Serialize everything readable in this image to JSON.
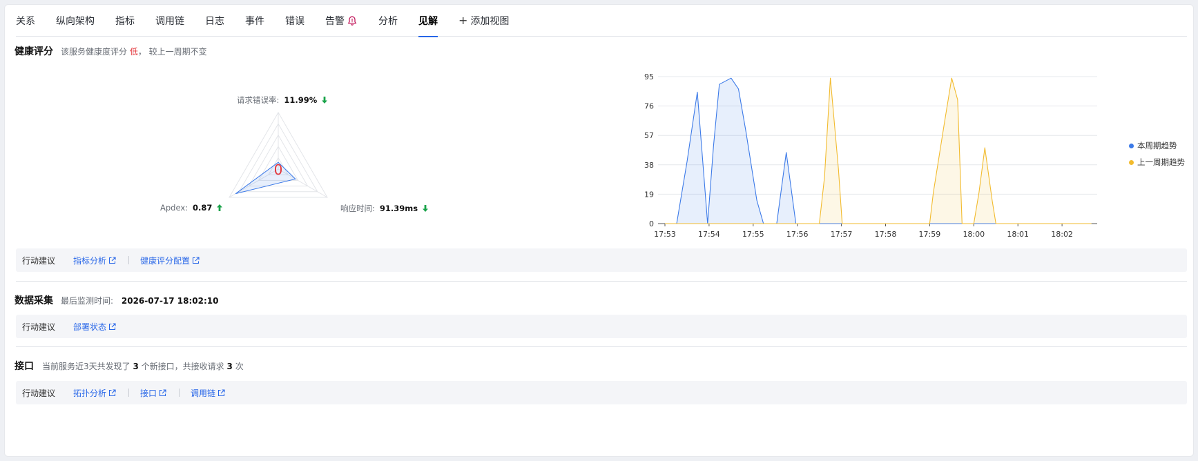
{
  "tabs": [
    "关系",
    "纵向架构",
    "指标",
    "调用链",
    "日志",
    "事件",
    "错误",
    "告警",
    "分析",
    "见解"
  ],
  "active_tab": "见解",
  "add_view_label": "添加视图",
  "health": {
    "title": "健康评分",
    "desc_prefix": "该服务健康度评分",
    "level": "低",
    "desc_suffix": "， 较上一周期不变",
    "score": "0",
    "error_rate_label": "请求错误率:",
    "error_rate_value": "11.99%",
    "apdex_label": "Apdex:",
    "apdex_value": "0.87",
    "resp_label": "响应时间:",
    "resp_value": "91.39ms",
    "radar_values": {
      "error_rate": 0.12,
      "apdex": 0.87,
      "response": 0.35
    }
  },
  "advice_label": "行动建议",
  "health_links": [
    "指标分析",
    "健康评分配置"
  ],
  "collect": {
    "title": "数据采集",
    "desc_label": "最后监测时间:",
    "last_time": "2026-07-17 18:02:10",
    "links": [
      "部署状态"
    ]
  },
  "api": {
    "title": "接口",
    "desc_p1": "当前服务近3天共发现了",
    "new_count": "3",
    "desc_p2": "个新接口，共接收请求",
    "req_count": "3",
    "desc_p3": "次",
    "links": [
      "拓扑分析",
      "接口",
      "调用链"
    ]
  },
  "colors": {
    "accent": "#2766e8",
    "current": "#3c7ae8",
    "previous": "#f2bb2e",
    "danger": "#e3363b",
    "good": "#1aa34a"
  },
  "chart_data": {
    "type": "area",
    "x_ticks": [
      "17:53",
      "17:54",
      "17:55",
      "17:56",
      "17:57",
      "17:58",
      "17:59",
      "18:00",
      "18:01",
      "18:02"
    ],
    "y_ticks": [
      0,
      19,
      38,
      57,
      76,
      95
    ],
    "ylim": [
      0,
      95
    ],
    "legend": [
      "本周期趋势",
      "上一周期趋势"
    ],
    "legend_position": "right",
    "grid": true,
    "series": [
      {
        "name": "本周期趋势",
        "points": [
          [
            "17:53:00",
            0
          ],
          [
            "17:53:16",
            0
          ],
          [
            "17:53:30",
            40
          ],
          [
            "17:53:44",
            85
          ],
          [
            "17:53:58",
            0
          ],
          [
            "17:54:06",
            50
          ],
          [
            "17:54:14",
            90
          ],
          [
            "17:54:30",
            94
          ],
          [
            "17:54:40",
            87
          ],
          [
            "17:54:50",
            60
          ],
          [
            "17:55:05",
            15
          ],
          [
            "17:55:14",
            0
          ],
          [
            "17:55:32",
            0
          ],
          [
            "17:55:45",
            46
          ],
          [
            "17:55:58",
            0
          ],
          [
            "17:56:30",
            0
          ],
          [
            "17:58:00",
            0
          ],
          [
            "18:02:40",
            0
          ]
        ]
      },
      {
        "name": "上一周期趋势",
        "points": [
          [
            "17:53:00",
            0
          ],
          [
            "17:56:30",
            0
          ],
          [
            "17:56:37",
            30
          ],
          [
            "17:56:45",
            94
          ],
          [
            "17:56:56",
            35
          ],
          [
            "17:57:01",
            0
          ],
          [
            "17:59:00",
            0
          ],
          [
            "17:59:05",
            20
          ],
          [
            "17:59:20",
            65
          ],
          [
            "17:59:30",
            94
          ],
          [
            "17:59:38",
            80
          ],
          [
            "17:59:44",
            0
          ],
          [
            "18:00:00",
            0
          ],
          [
            "18:00:07",
            20
          ],
          [
            "18:00:15",
            49
          ],
          [
            "18:00:25",
            15
          ],
          [
            "18:00:30",
            0
          ],
          [
            "18:02:40",
            0
          ]
        ]
      }
    ]
  }
}
